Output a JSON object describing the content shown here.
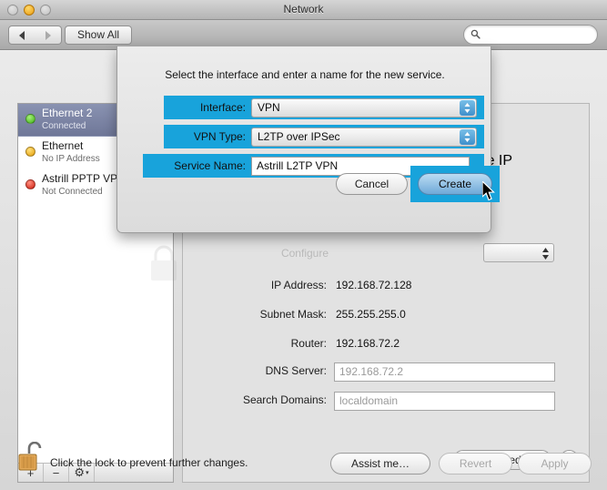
{
  "window": {
    "title": "Network",
    "traffic_lights": [
      "close-button",
      "minimize-button",
      "zoom-button"
    ]
  },
  "toolbar": {
    "back_label": "◀",
    "forward_label": "▶",
    "show_all_label": "Show All",
    "search_placeholder": "",
    "search_value": ""
  },
  "sidebar": {
    "services": [
      {
        "name": "Ethernet 2",
        "status": "Connected",
        "dot": "green",
        "selected": true
      },
      {
        "name": "Ethernet",
        "status": "No IP Address",
        "dot": "yellow",
        "selected": false
      },
      {
        "name": "Astrill PPTP VPN",
        "status": "Not Connected",
        "dot": "red",
        "selected": false
      }
    ],
    "add_label": "+",
    "remove_label": "−",
    "gear_label": "⚙"
  },
  "panel": {
    "status_note": "has the IP",
    "configure_label": "Configure",
    "fields": [
      {
        "label": "IP Address:",
        "value": "192.168.72.128"
      },
      {
        "label": "Subnet Mask:",
        "value": "255.255.255.0"
      },
      {
        "label": "Router:",
        "value": "192.168.72.2"
      }
    ],
    "inputs": [
      {
        "label": "DNS Server:",
        "value": "192.168.72.2"
      },
      {
        "label": "Search Domains:",
        "value": "localdomain"
      }
    ],
    "advanced_label": "Advanced…",
    "help_label": "?"
  },
  "bottom": {
    "lock_text": "Click the lock to prevent further changes.",
    "assist_label": "Assist me…",
    "revert_label": "Revert",
    "apply_label": "Apply"
  },
  "sheet": {
    "message": "Select the interface and enter a name for the new service.",
    "interface_label": "Interface:",
    "interface_value": "VPN",
    "vpn_type_label": "VPN Type:",
    "vpn_type_value": "L2TP over IPSec",
    "service_name_label": "Service Name:",
    "service_name_value": "Astrill L2TP VPN",
    "cancel_label": "Cancel",
    "create_label": "Create"
  },
  "colors": {
    "highlight": "#18a3db",
    "selection": "#6f7798",
    "default_button": "#6fa9d8"
  }
}
